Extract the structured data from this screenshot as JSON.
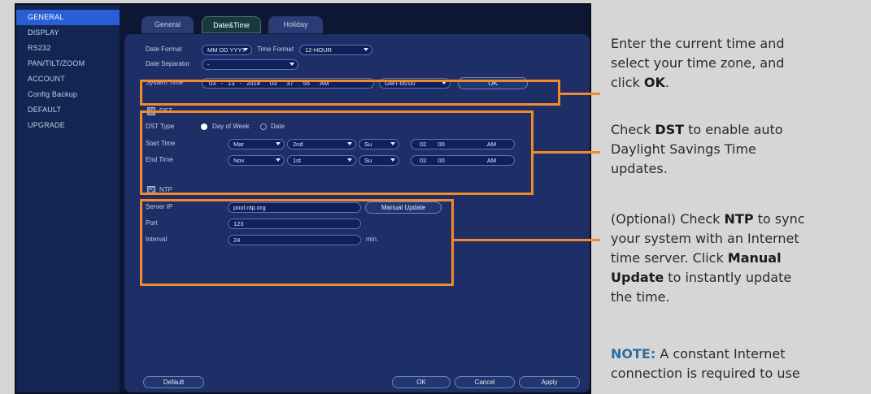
{
  "sidebar": {
    "items": [
      "GENERAL",
      "DISPLAY",
      "RS232",
      "PAN/TILT/ZOOM",
      "ACCOUNT",
      "Config Backup",
      "DEFAULT",
      "UPGRADE"
    ],
    "active_index": 0
  },
  "tabs": [
    "General",
    "Date&Time",
    "Holiday"
  ],
  "active_tab": "Date&Time",
  "datetime": {
    "date_format_label": "Date Format",
    "date_format_value": "MM DD YYYY",
    "time_format_label": "Time Format",
    "time_format_value": "12-HOUR",
    "date_separator_label": "Date Separator",
    "date_separator_value": "-",
    "system_time_label": "System Time",
    "sys_month": "03",
    "sys_day": "13",
    "sys_year": "2014",
    "sys_hour": "03",
    "sys_min": "37",
    "sys_sec": "55",
    "sys_ampm": "AM",
    "timezone_value": "GMT-05:00",
    "ok_label": "OK"
  },
  "dst": {
    "label": "DST",
    "checked": true,
    "type_label": "DST Type",
    "type_option_1": "Day of Week",
    "type_option_2": "Date",
    "start_label": "Start Time",
    "start_month": "Mar",
    "start_week": "2nd",
    "start_day": "Su",
    "start_hour": "02",
    "start_min": "00",
    "start_ampm": "AM",
    "end_label": "End Time",
    "end_month": "Nov",
    "end_week": "1st",
    "end_day": "Su",
    "end_hour": "02",
    "end_min": "00",
    "end_ampm": "AM"
  },
  "ntp": {
    "label": "NTP",
    "checked": true,
    "server_label": "Server IP",
    "server_value": "pool.ntp.org",
    "manual_update_label": "Manual Update",
    "port_label": "Port",
    "port_value": "123",
    "interval_label": "Interval",
    "interval_value": "24",
    "interval_unit": "min."
  },
  "footer": {
    "default_label": "Default",
    "ok_label": "OK",
    "cancel_label": "Cancel",
    "apply_label": "Apply"
  },
  "colors": {
    "highlight": "#f08a2a",
    "accent": "#2a5ed6",
    "note_title": "#2d6ea3"
  },
  "notes": {
    "note1_line1": "Enter the current time and",
    "note1_line2": "select your time zone, and",
    "note1_line3_pre": "click ",
    "note1_line3_bold": "OK",
    "note1_line3_post": ".",
    "note2_line1_pre": "Check ",
    "note2_line1_bold": "DST",
    "note2_line1_post": " to enable auto",
    "note2_line2": "Daylight Savings Time",
    "note2_line3": "updates.",
    "note3_line1_pre": "(Optional) Check ",
    "note3_line1_bold": "NTP",
    "note3_line1_post": " to sync",
    "note3_line2": "your system with an Internet",
    "note3_line3_pre": "time server. Click ",
    "note3_line3_bold": "Manual",
    "note3_line4_bold": "Update",
    "note3_line4_post": " to instantly update",
    "note3_line5": "the time.",
    "note4_title": "NOTE:",
    "note4_line1_post": " A constant Internet",
    "note4_line2": "connection is required to use"
  }
}
